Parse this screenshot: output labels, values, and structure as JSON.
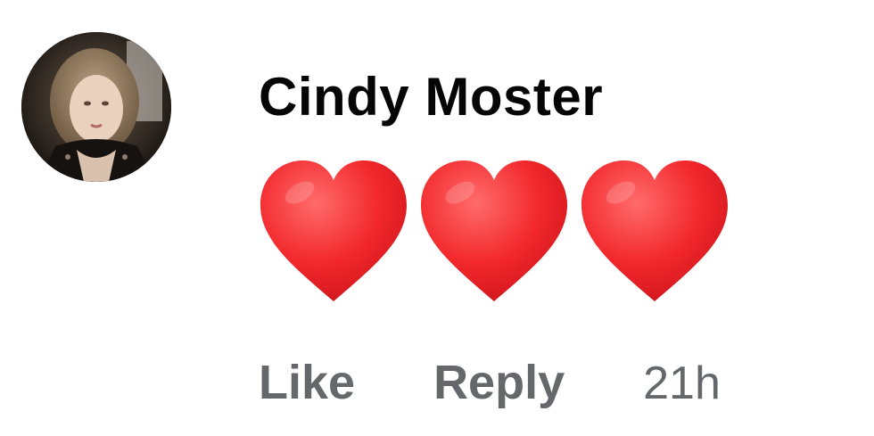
{
  "comment": {
    "author": "Cindy Moster",
    "body_icons": [
      "heart-icon",
      "heart-icon",
      "heart-icon"
    ],
    "actions": {
      "like": "Like",
      "reply": "Reply"
    },
    "timestamp": "21h"
  },
  "colors": {
    "name": "#050505",
    "meta": "#65676b",
    "heart": "#f2272b"
  }
}
